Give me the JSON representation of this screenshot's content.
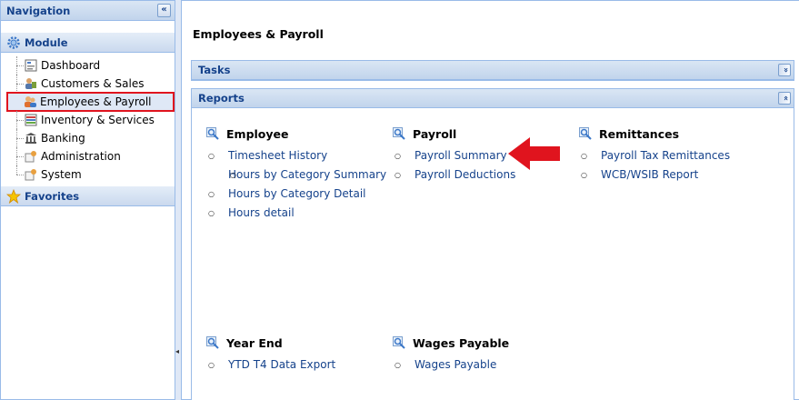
{
  "nav": {
    "title": "Navigation",
    "collapse_glyph": "«",
    "module_label": "Module",
    "favorites_label": "Favorites",
    "items": [
      {
        "label": "Dashboard"
      },
      {
        "label": "Customers & Sales"
      },
      {
        "label": "Employees & Payroll"
      },
      {
        "label": "Inventory & Services"
      },
      {
        "label": "Banking"
      },
      {
        "label": "Administration"
      },
      {
        "label": "System"
      }
    ]
  },
  "main": {
    "title": "Employees & Payroll",
    "tasks_label": "Tasks",
    "reports_label": "Reports",
    "expand_glyph": "»",
    "collapse_glyph": "«",
    "groups": {
      "employee": {
        "title": "Employee",
        "items": [
          "Timesheet History",
          "Hours by Category Summary",
          "Hours by Category Detail",
          "Hours detail"
        ]
      },
      "payroll": {
        "title": "Payroll",
        "items": [
          "Payroll Summary",
          "Payroll Deductions"
        ]
      },
      "remittances": {
        "title": "Remittances",
        "items": [
          "Payroll Tax Remittances",
          "WCB/WSIB Report"
        ]
      },
      "yearend": {
        "title": "Year End",
        "items": [
          "YTD T4 Data Export"
        ]
      },
      "wages": {
        "title": "Wages Payable",
        "items": [
          "Wages Payable"
        ]
      }
    }
  },
  "colors": {
    "accent": "#15428b",
    "highlight": "#e0141e",
    "border": "#99bbe8"
  }
}
